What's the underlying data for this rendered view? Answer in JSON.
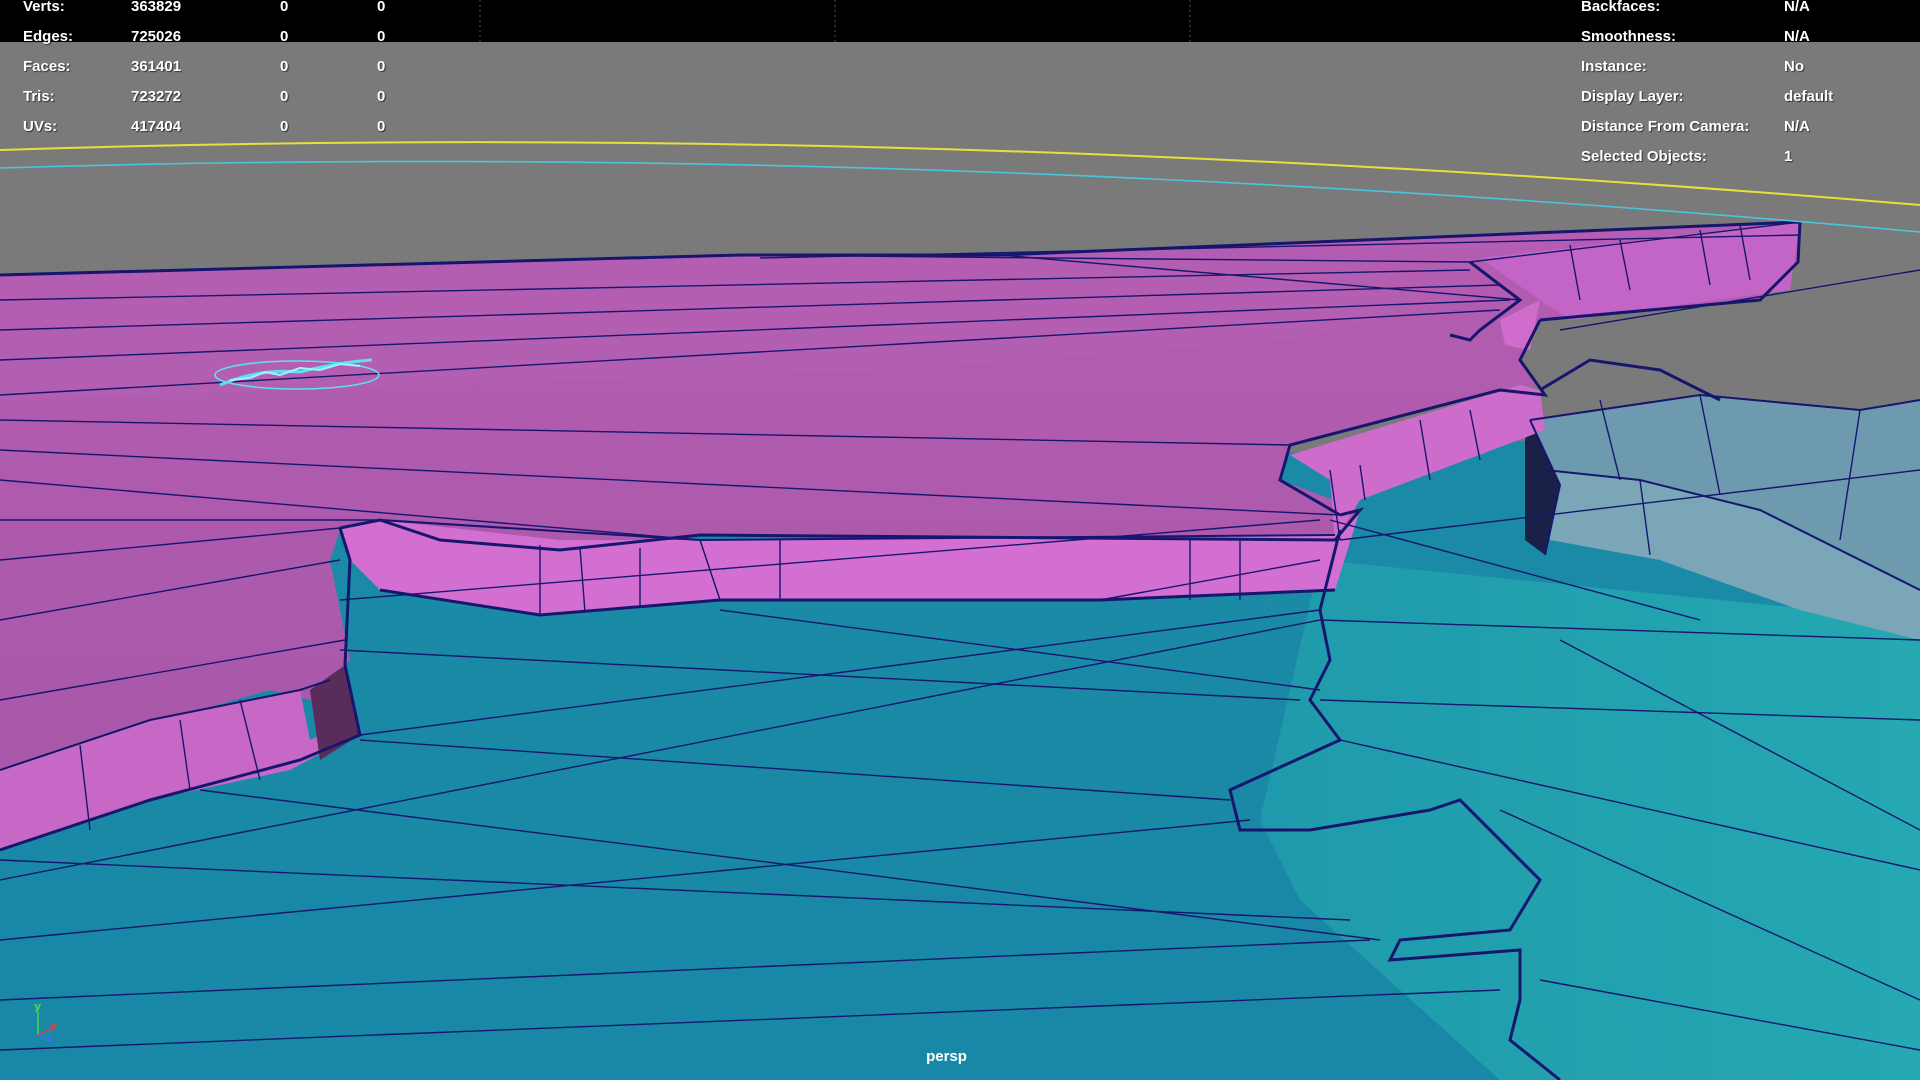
{
  "viewport": {
    "camera": "persp",
    "background_color": "#7a7a7a",
    "colors": {
      "selected_mesh": "#b05fb0",
      "selected_cliff": "#d46fd2",
      "water_mesh": "#1e8fa8",
      "water_mesh_light": "#23a3b0",
      "rock_mesh": "#6f9bb0",
      "wireframe": "#16166e",
      "manipulator_yellow": "#e8e03a",
      "manipulator_cyan": "#49c6dd",
      "gizmo_y": "#48d848",
      "gizmo_x": "#e04040",
      "gizmo_z": "#4a6cf0"
    }
  },
  "hud_stats": {
    "rows": [
      {
        "label": "Verts:",
        "value": "363829",
        "v2": "0",
        "v3": "0"
      },
      {
        "label": "Edges:",
        "value": "725026",
        "v2": "0",
        "v3": "0"
      },
      {
        "label": "Faces:",
        "value": "361401",
        "v2": "0",
        "v3": "0"
      },
      {
        "label": "Tris:",
        "value": "723272",
        "v2": "0",
        "v3": "0"
      },
      {
        "label": "UVs:",
        "value": "417404",
        "v2": "0",
        "v3": "0"
      }
    ]
  },
  "hud_info": {
    "rows": [
      {
        "label": "Backfaces:",
        "value": "N/A"
      },
      {
        "label": "Smoothness:",
        "value": "N/A"
      },
      {
        "label": "Instance:",
        "value": "No"
      },
      {
        "label": "Display Layer:",
        "value": "default"
      },
      {
        "label": "Distance From Camera:",
        "value": "N/A"
      },
      {
        "label": "Selected Objects:",
        "value": "1"
      }
    ]
  },
  "axis_gizmo": {
    "y_label": "y",
    "x_label": "x",
    "z_label": "z"
  }
}
